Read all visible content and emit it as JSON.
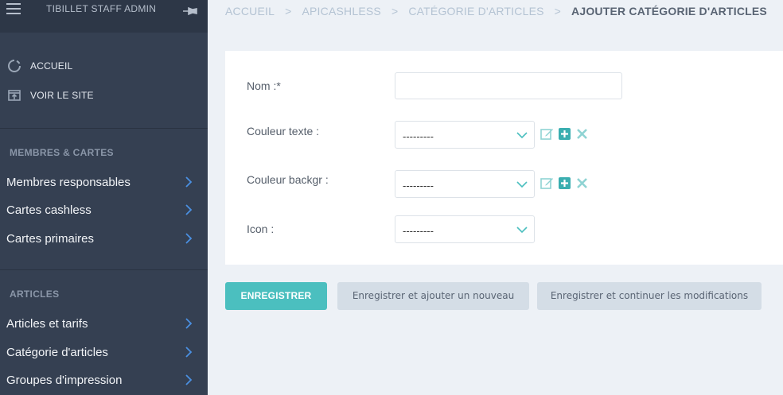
{
  "sidebar": {
    "title": "TIBILLET STAFF ADMIN",
    "quick_links": [
      {
        "label": "ACCUEIL",
        "icon": "home-circle-icon"
      },
      {
        "label": "VOIR LE SITE",
        "icon": "open-site-icon"
      }
    ],
    "sections": [
      {
        "title": "MEMBRES & CARTES",
        "items": [
          "Membres responsables",
          "Cartes cashless",
          "Cartes primaires"
        ]
      },
      {
        "title": "ARTICLES",
        "items": [
          "Articles et tarifs",
          "Catégorie d'articles",
          "Groupes d'impression"
        ]
      }
    ]
  },
  "breadcrumb": {
    "items": [
      "ACCUEIL",
      "APICASHLESS",
      "CATÉGORIE D'ARTICLES"
    ],
    "current": "AJOUTER CATÉGORIE D'ARTICLES"
  },
  "form": {
    "nom": {
      "label": "Nom :*",
      "value": ""
    },
    "couleur_texte": {
      "label": "Couleur texte :",
      "value": "---------"
    },
    "couleur_backgr": {
      "label": "Couleur backgr :",
      "value": "---------"
    },
    "icon": {
      "label": "Icon :",
      "value": "---------"
    }
  },
  "buttons": {
    "save": "ENREGISTRER",
    "save_add": "Enregistrer et ajouter un nouveau",
    "save_continue": "Enregistrer et continuer les modifications"
  },
  "colors": {
    "sidebar_bg": "#354052",
    "accent": "#4bbfbf",
    "link_blue": "#4a90e2"
  }
}
